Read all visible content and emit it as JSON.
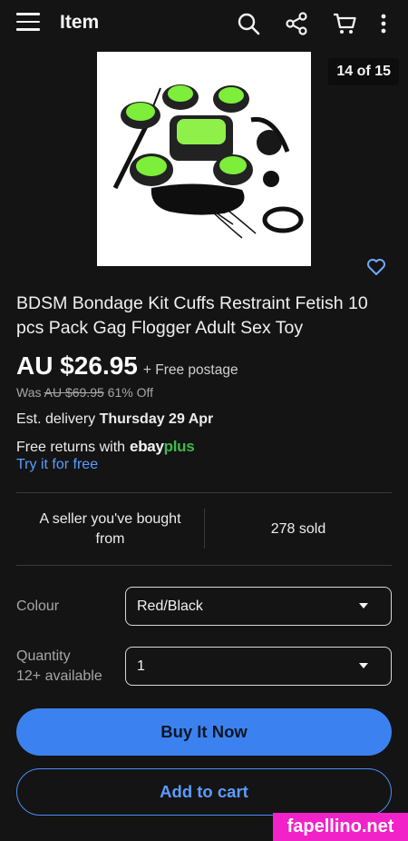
{
  "header": {
    "title": "Item"
  },
  "gallery": {
    "counter": "14 of 15"
  },
  "product": {
    "title": "BDSM Bondage Kit Cuffs Restraint Fetish 10 pcs Pack Gag Flogger Adult Sex Toy",
    "price": "AU $26.95",
    "postage": "+ Free postage",
    "was_label": "Was",
    "was_price": "AU $69.95",
    "discount": "61% Off"
  },
  "delivery": {
    "prefix": "Est. delivery",
    "date": "Thursday 29 Apr"
  },
  "returns": {
    "text": "Free returns with",
    "brand_e": "ebay",
    "brand_p": "plus",
    "try_link": "Try it for free"
  },
  "stats": {
    "seller_note": "A seller you've bought from",
    "sold": "278 sold"
  },
  "options": {
    "colour_label": "Colour",
    "colour_value": "Red/Black",
    "quantity_label": "Quantity",
    "quantity_available": "12+ available",
    "quantity_value": "1"
  },
  "actions": {
    "buy_now": "Buy It Now",
    "add_to_cart": "Add to cart"
  },
  "watermark": "fapellino.net",
  "colors": {
    "background": "#141414",
    "accent_blue": "#3b82f0",
    "link_blue": "#5b9cff",
    "ebayplus_green": "#3fb94a",
    "watermark_magenta": "#f022c8"
  },
  "icons": [
    "menu-icon",
    "search-icon",
    "share-icon",
    "cart-icon",
    "more-vertical-icon",
    "heart-outline-icon",
    "chevron-down-icon"
  ]
}
